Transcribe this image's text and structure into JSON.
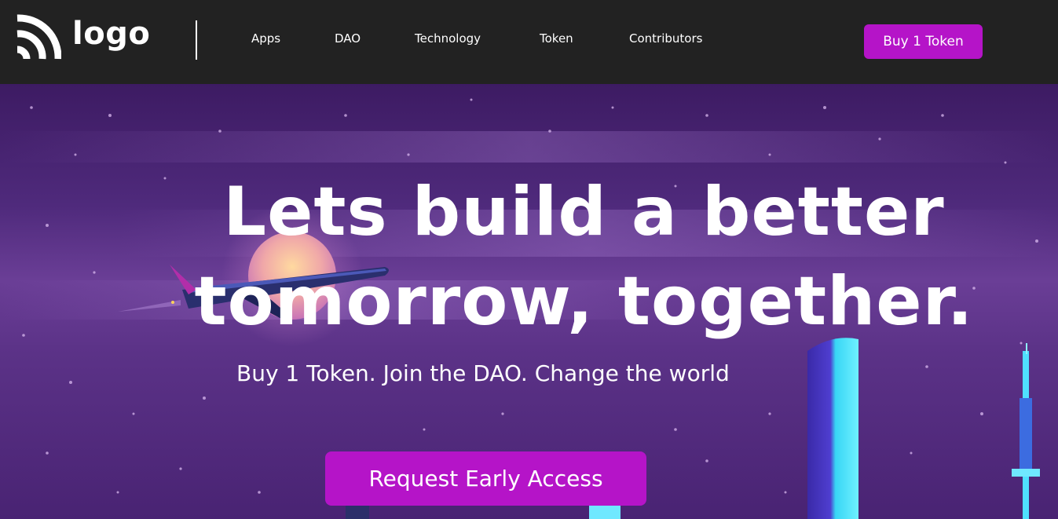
{
  "header": {
    "logo_text": "logo",
    "nav": [
      "Apps",
      "DAO",
      "Technology",
      "Token",
      "Contributors"
    ],
    "cta_label": "Buy 1 Token"
  },
  "hero": {
    "title_line1": "Lets build a better",
    "title_line2": "tomorrow, together.",
    "subtitle": "Buy 1 Token. Join the DAO. Change the world",
    "cta_label": "Request Early Access"
  },
  "colors": {
    "header_bg": "#222222",
    "accent": "#b514c8",
    "hero_purple": "#4f2a7c",
    "text": "#ffffff"
  }
}
